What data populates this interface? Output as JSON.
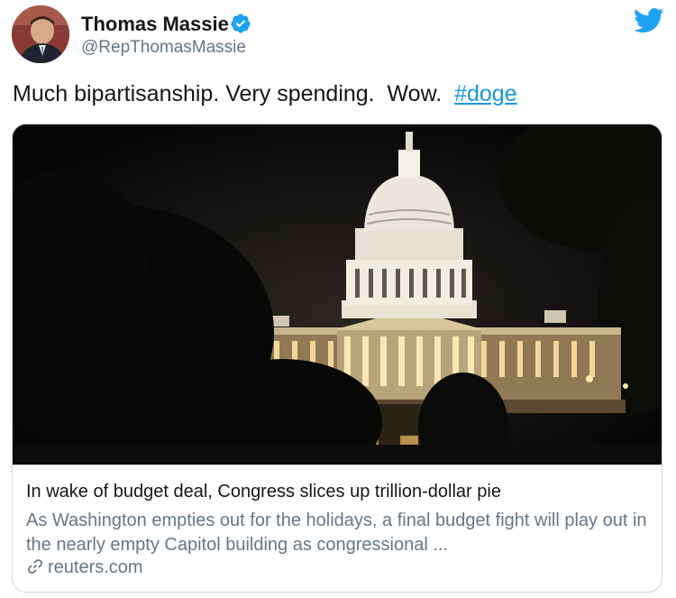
{
  "author": {
    "name": "Thomas Massie",
    "handle": "@RepThomasMassie",
    "avatar_icon": "avatar",
    "verified_icon": "verified-badge-icon",
    "verified_color": "#1da1f2"
  },
  "brand": {
    "logo_icon": "twitter-bird-icon",
    "color": "#1da1f2"
  },
  "tweet": {
    "text": "Much bipartisanship. Very spending.  Wow.  ",
    "hashtag": "#doge",
    "hashtag_color": "#1b95e0"
  },
  "card": {
    "image_icon": "us-capitol-at-night-image",
    "title": "In wake of budget deal, Congress slices up trillion-dollar pie",
    "description": "As Washington empties out for the holidays, a final budget fight will play out in the nearly empty Capitol building as congressional ...",
    "source_icon": "link-icon",
    "source": "reuters.com"
  }
}
